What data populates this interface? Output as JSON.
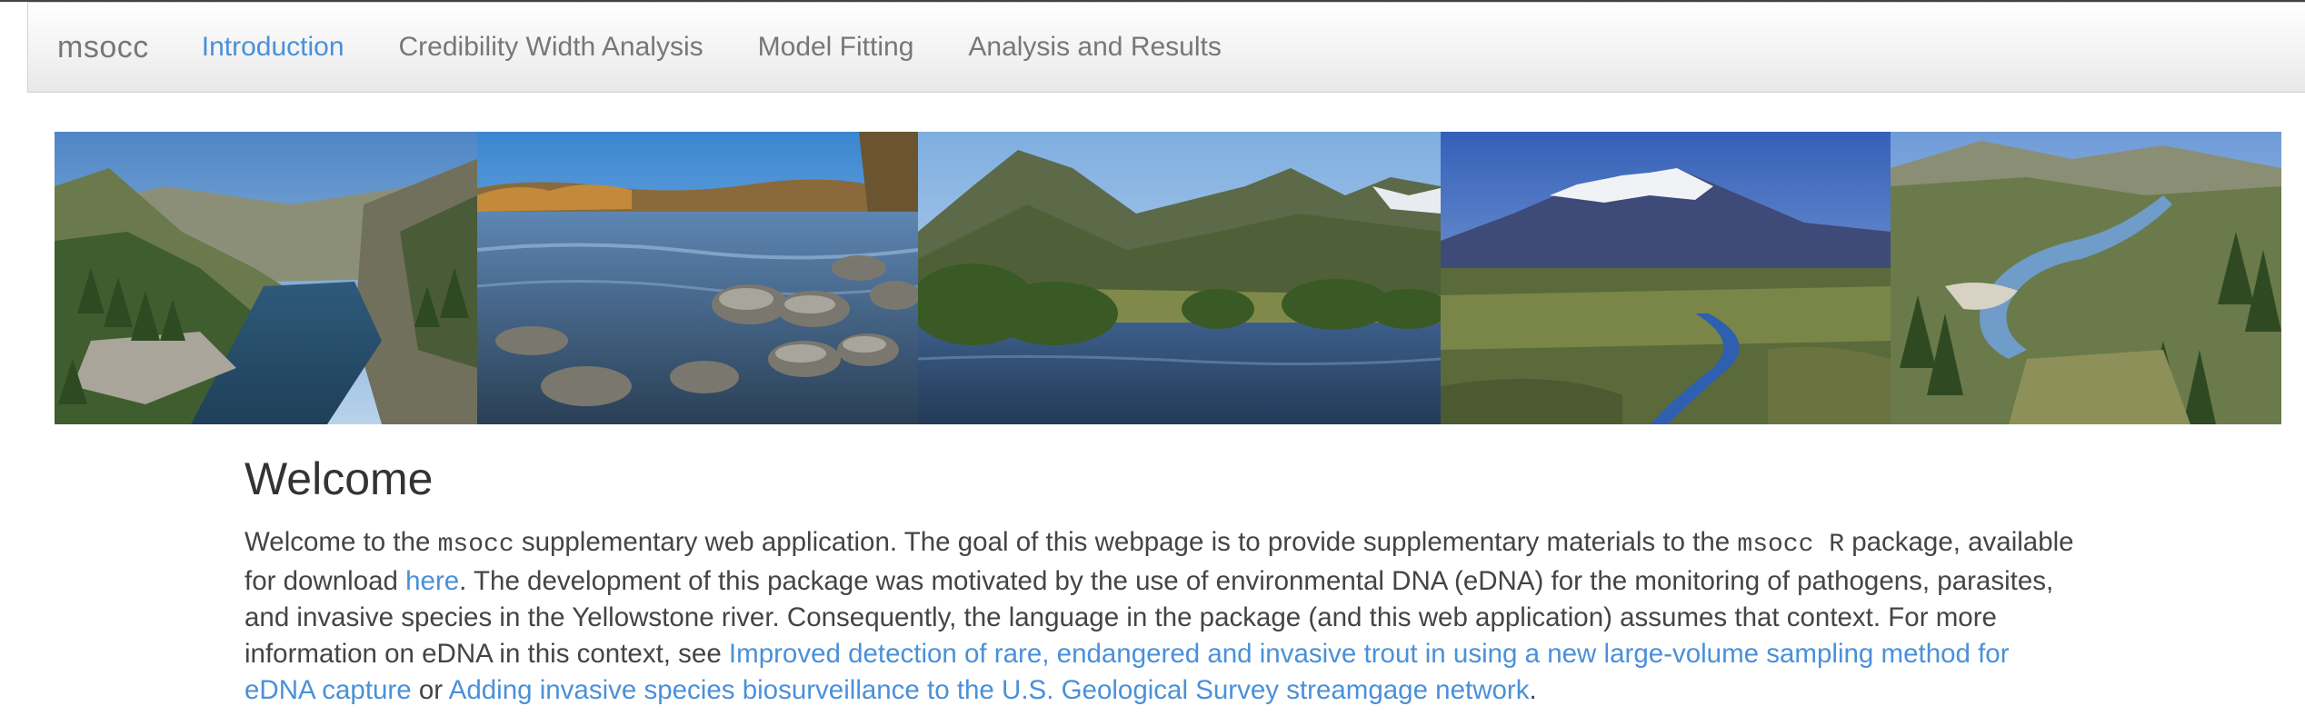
{
  "nav": {
    "brand": "msocc",
    "tabs": [
      {
        "label": "Introduction",
        "active": true
      },
      {
        "label": "Credibility Width Analysis",
        "active": false
      },
      {
        "label": "Model Fitting",
        "active": false
      },
      {
        "label": "Analysis and Results",
        "active": false
      }
    ]
  },
  "banner": {
    "photos": [
      "river-canyon-photo",
      "rocky-river-photo",
      "mountain-river-photo",
      "snowy-mountain-valley-photo",
      "meandering-river-valley-photo"
    ]
  },
  "main": {
    "title": "Welcome",
    "para": {
      "t1": "Welcome to the ",
      "code1": "msocc",
      "t2": " supplementary web application. The goal of this webpage is to provide supplementary materials to the ",
      "code2": "msocc R",
      "t3": " package, available for download ",
      "link_here": "here",
      "t4": ". The development of this package was motivated by the use of environmental DNA (eDNA) for the monitoring of pathogens, parasites, and invasive species in the Yellowstone river. Consequently, the language in the package (and this web application) assumes that context. For more information on eDNA in this context, see ",
      "link_trout": "Improved detection of rare, endangered and invasive trout in using a new large-volume sampling method for eDNA capture",
      "t5": " or ",
      "link_usgs": "Adding invasive species biosurveillance to the U.S. Geological Survey streamgage network",
      "t6": "."
    }
  },
  "colors": {
    "link": "#4a90d9",
    "text": "#444444",
    "nav_text": "#777777"
  }
}
